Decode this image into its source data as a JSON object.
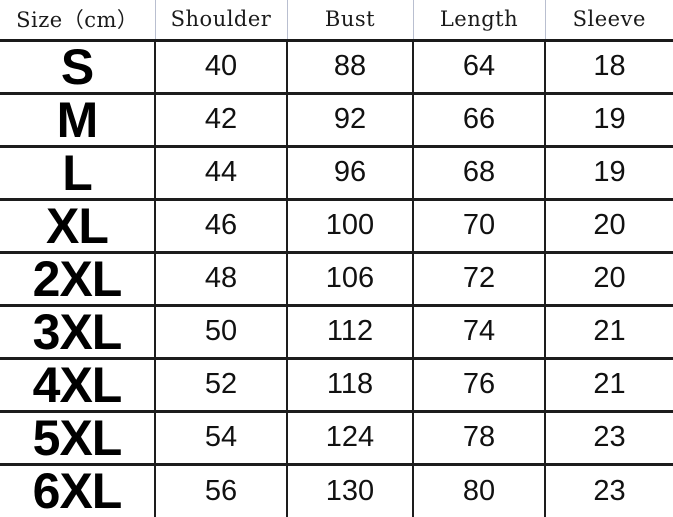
{
  "table": {
    "columns": [
      {
        "key": "size",
        "label": "Size（cm）"
      },
      {
        "key": "shoulder",
        "label": "Shoulder"
      },
      {
        "key": "bust",
        "label": "Bust"
      },
      {
        "key": "length",
        "label": "Length"
      },
      {
        "key": "sleeve",
        "label": "Sleeve"
      }
    ],
    "rows": [
      {
        "size": "S",
        "shoulder": "40",
        "bust": "88",
        "length": "64",
        "sleeve": "18"
      },
      {
        "size": "M",
        "shoulder": "42",
        "bust": "92",
        "length": "66",
        "sleeve": "19"
      },
      {
        "size": "L",
        "shoulder": "44",
        "bust": "96",
        "length": "68",
        "sleeve": "19"
      },
      {
        "size": "XL",
        "shoulder": "46",
        "bust": "100",
        "length": "70",
        "sleeve": "20"
      },
      {
        "size": "2XL",
        "shoulder": "48",
        "bust": "106",
        "length": "72",
        "sleeve": "20"
      },
      {
        "size": "3XL",
        "shoulder": "50",
        "bust": "112",
        "length": "74",
        "sleeve": "21"
      },
      {
        "size": "4XL",
        "shoulder": "52",
        "bust": "118",
        "length": "76",
        "sleeve": "21"
      },
      {
        "size": "5XL",
        "shoulder": "54",
        "bust": "124",
        "length": "78",
        "sleeve": "23"
      },
      {
        "size": "6XL",
        "shoulder": "56",
        "bust": "130",
        "length": "80",
        "sleeve": "23"
      }
    ]
  },
  "colors": {
    "grid_line": "#1d1d1d",
    "header_separator": "#b9bfd0",
    "text": "#111111",
    "background": "#ffffff"
  }
}
